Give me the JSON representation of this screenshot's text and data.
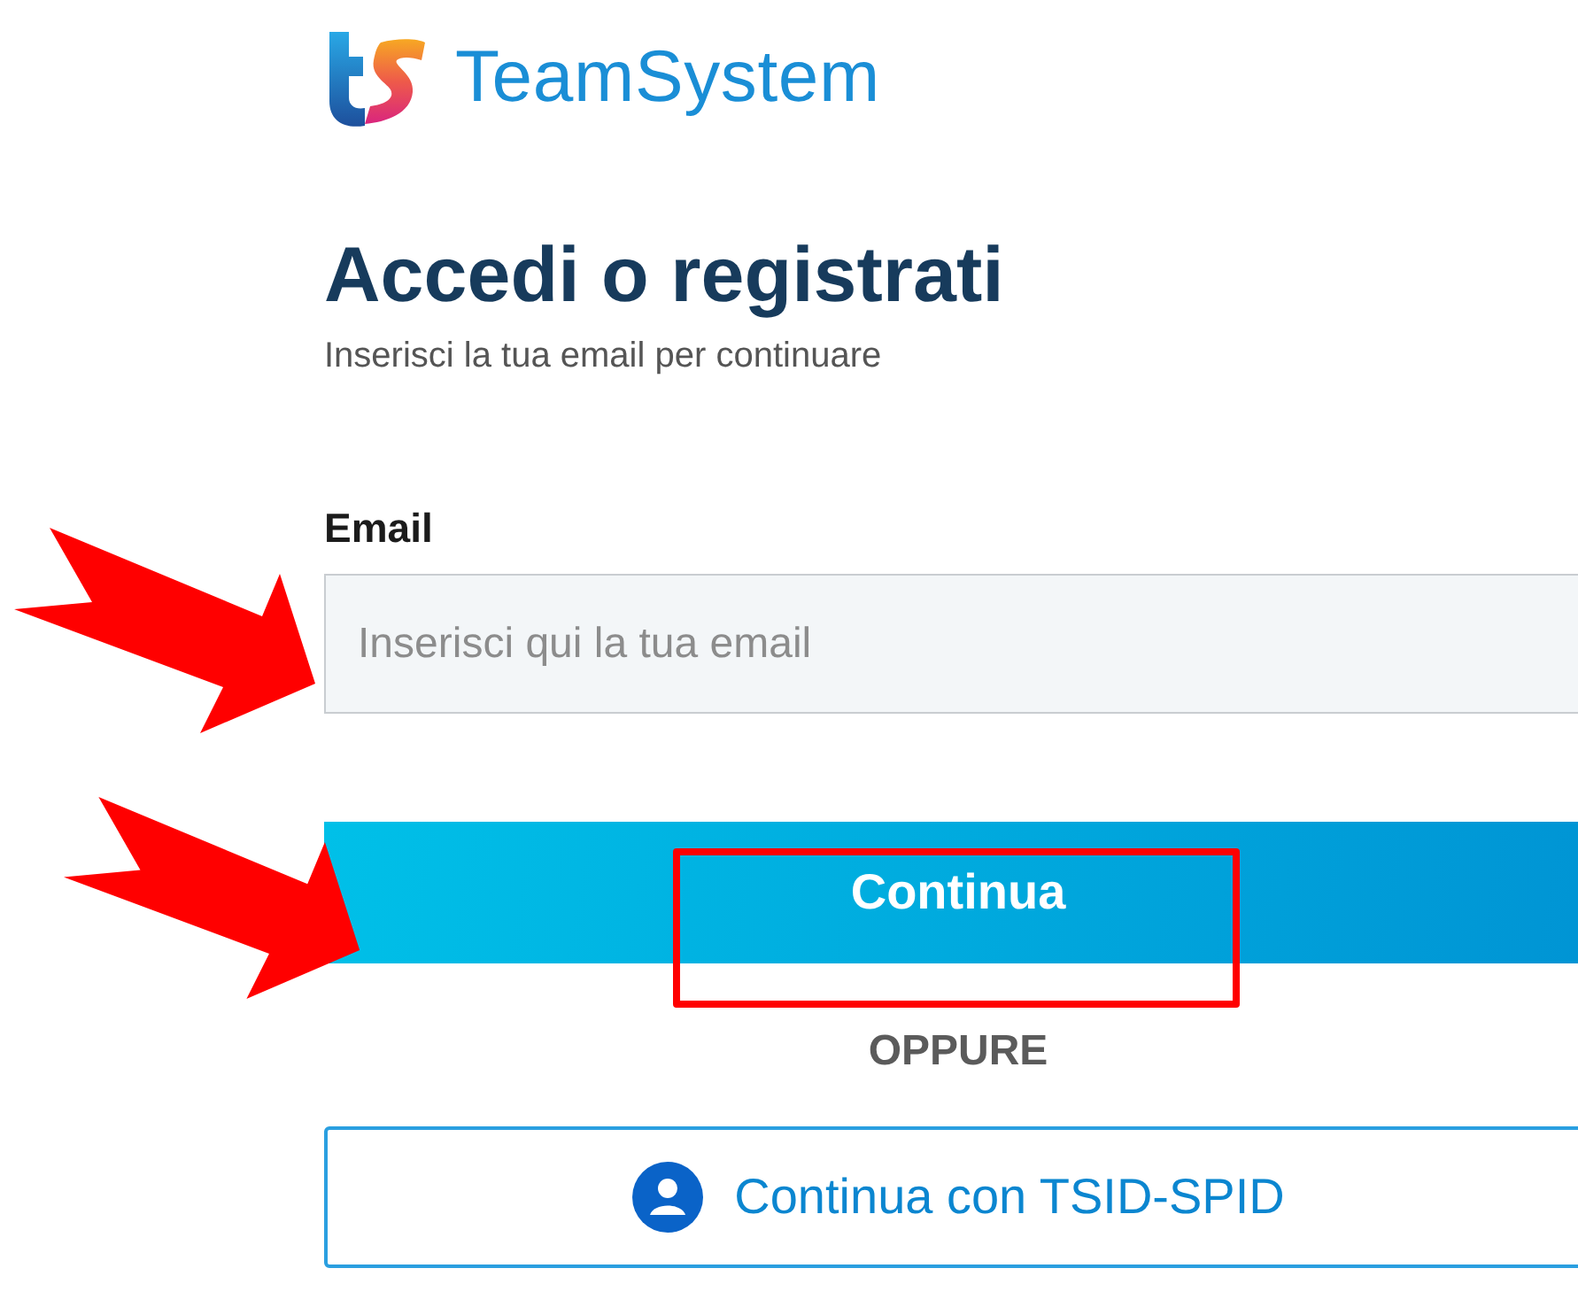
{
  "logo": {
    "name": "TeamSystem"
  },
  "heading": "Accedi o registrati",
  "subtitle": "Inserisci la tua email per continuare",
  "email_field": {
    "label": "Email",
    "placeholder": "Inserisci qui la tua email"
  },
  "primary_button": {
    "label": "Continua"
  },
  "divider_text": "OPPURE",
  "secondary_button": {
    "label": "Continua con TSID-SPID"
  },
  "annotations": [
    {
      "kind": "arrow"
    },
    {
      "kind": "arrow"
    },
    {
      "kind": "frame"
    }
  ]
}
